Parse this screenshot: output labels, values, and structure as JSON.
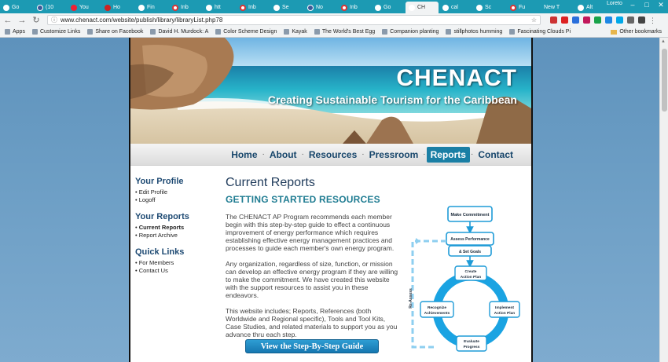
{
  "browser": {
    "tabs": [
      {
        "label": "Go",
        "icon": "google-icon"
      },
      {
        "label": "(10",
        "icon": "facebook-icon"
      },
      {
        "label": "You",
        "icon": "youtube-icon"
      },
      {
        "label": "Ho",
        "icon": "pinterest-icon"
      },
      {
        "label": "Fin",
        "icon": "doc-icon"
      },
      {
        "label": "Inb",
        "icon": "gmail-icon"
      },
      {
        "label": "htt",
        "icon": "google-icon"
      },
      {
        "label": "Inb",
        "icon": "gmail-icon"
      },
      {
        "label": "Se",
        "icon": "doc-icon"
      },
      {
        "label": "No",
        "icon": "facebook-icon"
      },
      {
        "label": "Inb",
        "icon": "gmail-icon"
      },
      {
        "label": "Go",
        "icon": "google-icon"
      },
      {
        "label": "CH",
        "icon": "doc-icon",
        "active": true
      },
      {
        "label": "cal",
        "icon": "google-icon"
      },
      {
        "label": "Sc",
        "icon": "google-icon"
      },
      {
        "label": "Fu",
        "icon": "gmail-icon"
      },
      {
        "label": "New T",
        "icon": "none"
      },
      {
        "label": "Alt",
        "icon": "google-icon"
      }
    ],
    "user": "Loreto",
    "url": "www.chenact.com/website/publish/library/libraryList.php78",
    "bookmarks": [
      {
        "label": "Apps"
      },
      {
        "label": "Customize Links"
      },
      {
        "label": "Share on Facebook"
      },
      {
        "label": "David H. Murdock: A"
      },
      {
        "label": "Color Scheme Design"
      },
      {
        "label": "Kayak"
      },
      {
        "label": "The World's Best Egg"
      },
      {
        "label": "Companion planting"
      },
      {
        "label": "stillphotos humming"
      },
      {
        "label": "Fascinating Clouds Pi"
      }
    ],
    "other_bookmarks": "Other bookmarks"
  },
  "site": {
    "brand": "CHENACT",
    "tagline": "Creating Sustainable Tourism for the Caribbean",
    "nav": [
      "Home",
      "About",
      "Resources",
      "Pressroom",
      "Reports",
      "Contact"
    ],
    "active_nav": "Reports"
  },
  "sidebar": {
    "profile": {
      "title": "Your Profile",
      "items": [
        "Edit Profile",
        "Logoff"
      ]
    },
    "reports": {
      "title": "Your Reports",
      "items": [
        "Current Reports",
        "Report Archive"
      ]
    },
    "quick": {
      "title": "Quick Links",
      "items": [
        "For Members",
        "Contact Us"
      ]
    }
  },
  "main": {
    "title": "Current Reports",
    "subtitle": "GETTING STARTED RESOURCES",
    "p1": "The CHENACT AP Program recommends each member begin with this step-by-step guide to effect a continuous improvement of energy performance which requires establishing effective energy management practices and processes to guide each member's own energy program.",
    "p2": "Any organization, regardless of size, function, or mission can develop an effective energy program if they are willing to make the commitment. We have created this website with the support resources to assist you in these endeavors.",
    "p3": "This website includes; Reports, References (both Worldwide and Regional specific), Tools and Tool Kits, Case Studies, and related materials to support you as you advance thru each step.",
    "button": "View the Step-By-Step Guide"
  },
  "diagram": {
    "commit": "Make Commitment",
    "assess1": "Assess Performance",
    "assess2": "& Set Goals",
    "create1": "Create",
    "create2": "Action Plan",
    "implement1": "Implement",
    "implement2": "Action Plan",
    "evaluate1": "Evaluate",
    "evaluate2": "Progress",
    "recognize1": "Recognize",
    "recognize2": "Achievements",
    "reassess": "Re-Assess"
  }
}
